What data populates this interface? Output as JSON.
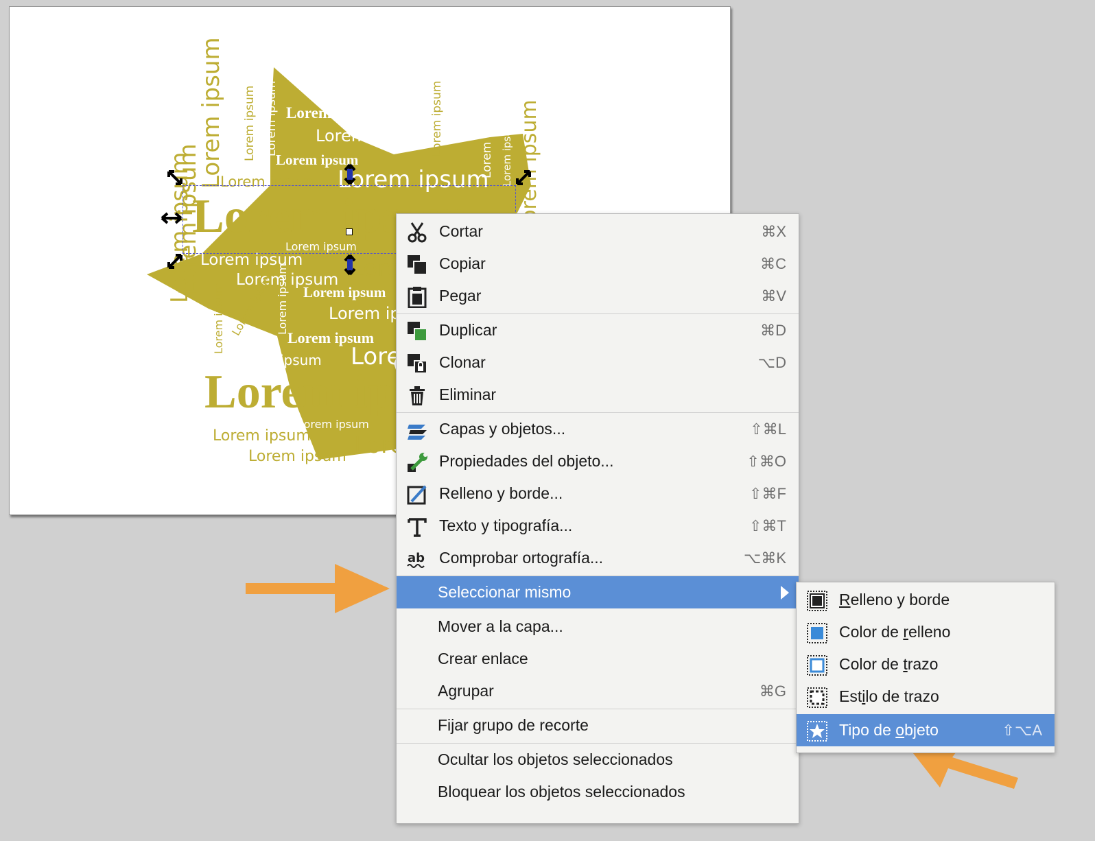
{
  "canvas": {
    "words": "Lorem ipsum"
  },
  "context_menu": {
    "items": [
      {
        "label": "Cortar",
        "shortcut": "⌘X",
        "icon": "scissors-icon"
      },
      {
        "label": "Copiar",
        "shortcut": "⌘C",
        "icon": "copy-icon"
      },
      {
        "label": "Pegar",
        "shortcut": "⌘V",
        "icon": "paste-icon"
      },
      {
        "label": "Duplicar",
        "shortcut": "⌘D",
        "icon": "duplicate-icon"
      },
      {
        "label": "Clonar",
        "shortcut": "⌥D",
        "icon": "clone-icon"
      },
      {
        "label": "Eliminar",
        "shortcut": "",
        "icon": "trash-icon"
      },
      {
        "label": "Capas y objetos...",
        "shortcut": "⇧⌘L",
        "icon": "layers-icon"
      },
      {
        "label": "Propiedades del objeto...",
        "shortcut": "⇧⌘O",
        "icon": "wrench-icon"
      },
      {
        "label": "Relleno y borde...",
        "shortcut": "⇧⌘F",
        "icon": "fill-stroke-icon"
      },
      {
        "label": "Texto y tipografía...",
        "shortcut": "⇧⌘T",
        "icon": "text-icon"
      },
      {
        "label": "Comprobar ortografía...",
        "shortcut": "⌥⌘K",
        "icon": "spellcheck-icon"
      },
      {
        "label": "Seleccionar mismo",
        "shortcut": "",
        "icon": "submenu-arrow-icon"
      },
      {
        "label": "Mover a la capa...",
        "shortcut": ""
      },
      {
        "label": "Crear enlace",
        "shortcut": ""
      },
      {
        "label": "Agrupar",
        "shortcut": "⌘G"
      },
      {
        "label": "Fijar grupo de recorte",
        "shortcut": ""
      },
      {
        "label": "Ocultar los objetos seleccionados",
        "shortcut": ""
      },
      {
        "label": "Bloquear los objetos seleccionados",
        "shortcut": ""
      }
    ]
  },
  "submenu": {
    "items": [
      {
        "pre": "",
        "u": "R",
        "post": "elleno y borde",
        "shortcut": "",
        "icon": "same-fill-stroke-icon"
      },
      {
        "pre": "Color de ",
        "u": "r",
        "post": "elleno",
        "shortcut": "",
        "icon": "same-fill-color-icon"
      },
      {
        "pre": "Color de ",
        "u": "t",
        "post": "razo",
        "shortcut": "",
        "icon": "same-stroke-color-icon"
      },
      {
        "pre": "Est",
        "u": "i",
        "post": "lo de trazo",
        "shortcut": "",
        "icon": "same-stroke-style-icon"
      },
      {
        "pre": "Tipo de ",
        "u": "o",
        "post": "bjeto",
        "shortcut": "⇧⌥A",
        "icon": "same-object-type-icon"
      }
    ]
  },
  "colors": {
    "accent": "#5b8fd6",
    "art": "#bdad33",
    "callout": "#f0a040"
  }
}
